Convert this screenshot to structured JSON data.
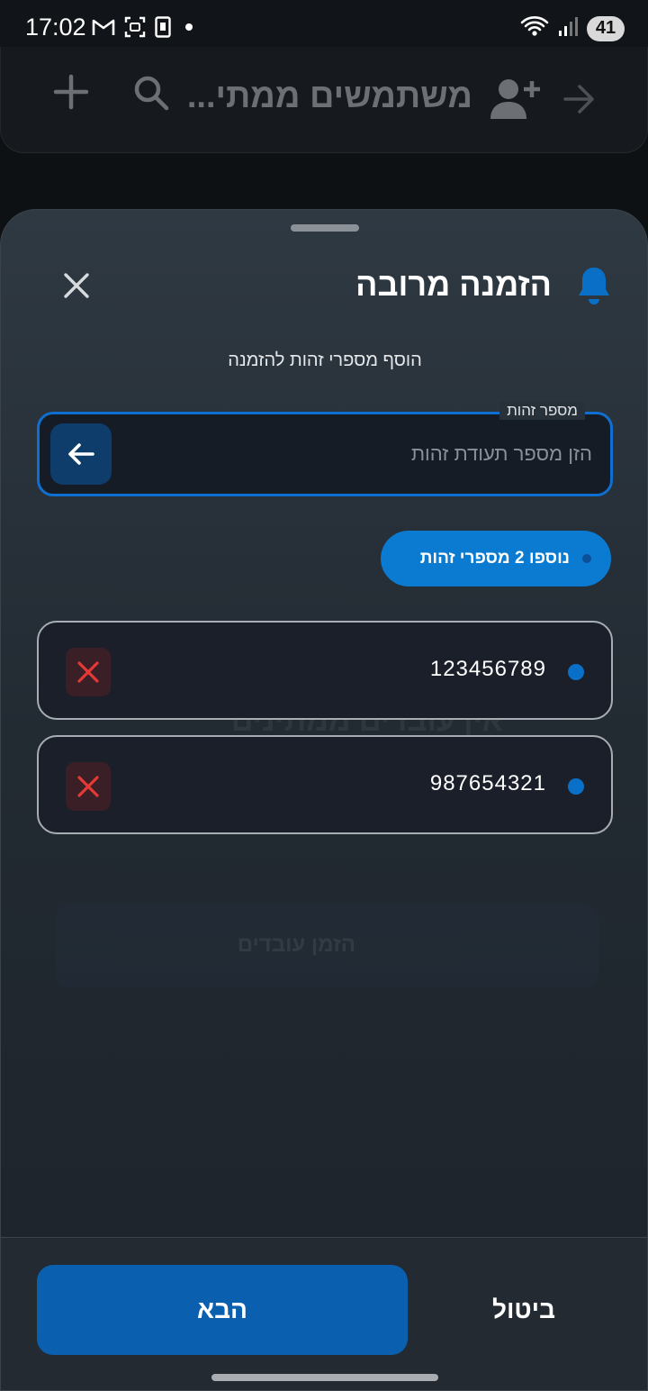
{
  "status_bar": {
    "time": "17:02",
    "battery": "41",
    "icons": [
      "gmail-icon",
      "screenshot-icon",
      "sim-icon",
      "dot-icon",
      "wifi-icon",
      "signal-icon"
    ]
  },
  "app_header": {
    "title": "משתמשים ממתי...",
    "icons": [
      "back-arrow-icon",
      "add-user-icon",
      "search-icon",
      "plus-icon"
    ]
  },
  "sheet": {
    "title": "הזמנה מרובה",
    "subtitle": "הוסף מספרי זהות להזמנה",
    "id_field": {
      "label": "מספר זהות",
      "placeholder": "הזן מספר תעודת זהות",
      "value": ""
    },
    "count_chip": "נוספו 2 מספרי זהות",
    "ids": [
      {
        "value": "123456789"
      },
      {
        "value": "987654321"
      }
    ],
    "footer": {
      "next_label": "הבא",
      "cancel_label": "ביטול"
    }
  },
  "background_ghost": {
    "empty_text": "אין עובדים ממתינים",
    "invite_label": "הזמן עובדים"
  },
  "colors": {
    "accent": "#0a7bd0",
    "primary_button": "#0a5fae",
    "remove_red": "#e53935"
  }
}
